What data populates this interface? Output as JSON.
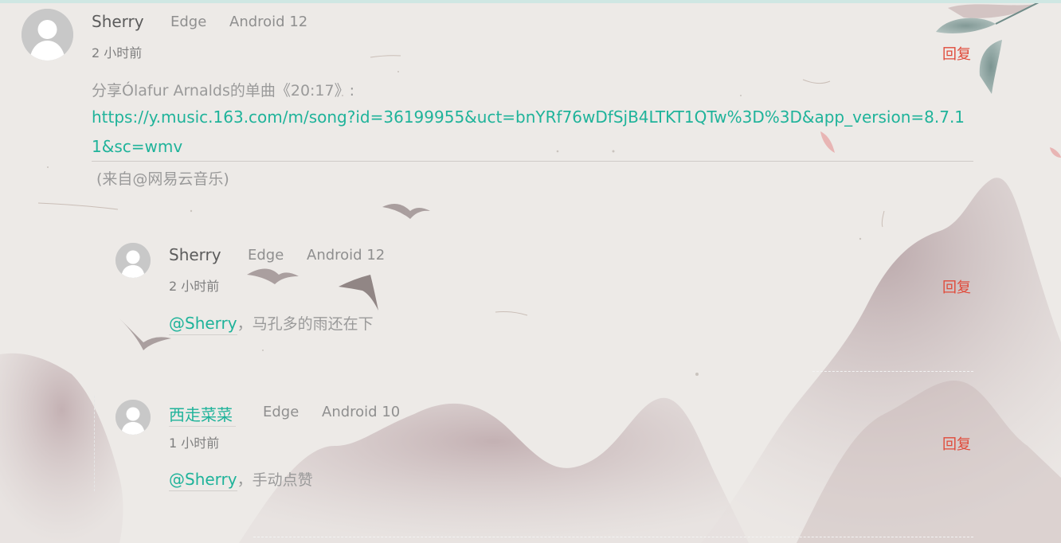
{
  "comments": [
    {
      "author": "Sherry",
      "browser": "Edge",
      "os": "Android 12",
      "time": "2 小时前",
      "reply_label": "回复",
      "share_text": "分享Ólafur Arnalds的单曲《20:17》:",
      "url_line1": "https://y.music.163.com/m/song?id=36199955&uct=bnYRf76wDfSjB4LTKT1QTw%3D%3D&app_version=8.7.1",
      "url_line2": "1&sc=wmv",
      "source_text": "(来自@网易云音乐)"
    },
    {
      "author": "Sherry",
      "browser": "Edge",
      "os": "Android 12",
      "time": "2 小时前",
      "reply_label": "回复",
      "mention": "@Sherry",
      "text": "，马孔多的雨还在下"
    },
    {
      "author": "西走菜菜",
      "browser": "Edge",
      "os": "Android 10",
      "time": "1 小时前",
      "reply_label": "回复",
      "mention": "@Sherry",
      "text": "，手动点赞"
    }
  ],
  "colors": {
    "link": "#1fb39a",
    "reply": "#e04a3a",
    "paper": "#ece9e6"
  },
  "icons": [
    "avatar-placeholder-icon"
  ]
}
